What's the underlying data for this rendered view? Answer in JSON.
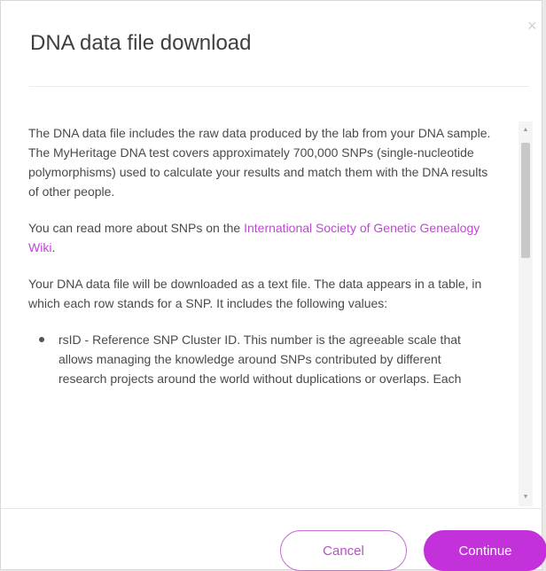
{
  "dialog": {
    "title": "DNA data file download",
    "close_symbol": "×"
  },
  "content": {
    "paragraph1": "The DNA data file includes the raw data produced by the lab from your DNA sample. The MyHeritage DNA test covers approximately 700,000 SNPs (single-nucleotide polymorphisms) used to calculate your results and match them with the DNA results of other people.",
    "paragraph2_prefix": "You can read more about SNPs on the ",
    "paragraph2_link": "International Society of Genetic Genealogy Wiki",
    "paragraph2_suffix": ".",
    "paragraph3": "Your DNA data file will be downloaded as a text file. The data appears in a table, in which each row stands for a SNP. It includes the following values:",
    "list_items": [
      "rsID - Reference SNP Cluster ID. This number is the agreeable scale that allows managing the knowledge around SNPs contributed by different research projects around the world without duplications or overlaps. Each"
    ]
  },
  "scrollbar": {
    "up_icon": "▲",
    "down_icon": "▼"
  },
  "footer": {
    "cancel_label": "Cancel",
    "continue_label": "Continue"
  },
  "colors": {
    "accent": "#c231d9",
    "link": "#c146d6"
  }
}
